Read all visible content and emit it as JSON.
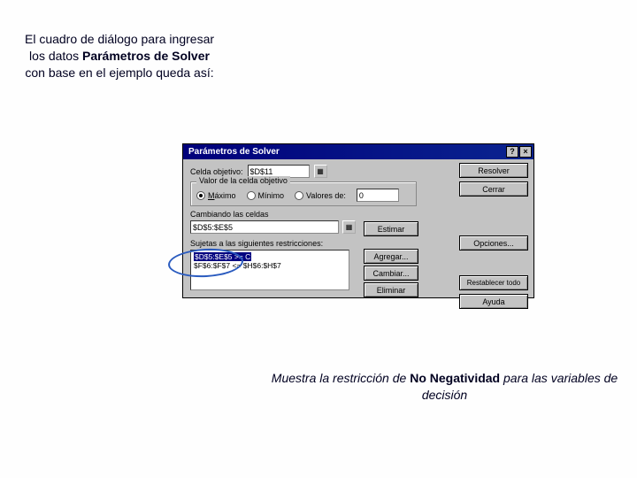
{
  "captionTop": {
    "line1": "El cuadro de diálogo para ingresar los datos ",
    "bold": "Parámetros de Solver",
    "line2": " con base en el ejemplo queda así:"
  },
  "captionBottom": {
    "pre": "Muestra la restricción de ",
    "bold": "No Negatividad",
    "post": " para las variables de decisión"
  },
  "dialog": {
    "title": "Parámetros de Solver",
    "helpGlyph": "?",
    "closeGlyph": "×",
    "labels": {
      "celdaObjetivo": "Celda objetivo:",
      "valorCelda": "Valor de la celda objetivo",
      "maximo": "Máximo",
      "minimo": "Mínimo",
      "valoresDe": "Valores de:",
      "cambiando": "Cambiando las celdas",
      "sujetas": "Sujetas a las siguientes restricciones:"
    },
    "inputs": {
      "objetivo": "$D$11",
      "valoresDe": "0",
      "cambiando": "$D$5:$E$5",
      "valoresPh": ""
    },
    "constraints": [
      "$D$5:$E$5 >= C",
      "$F$6:$F$7 <= $H$6:$H$7"
    ],
    "buttons": {
      "resolver": "Resolver",
      "cerrar": "Cerrar",
      "opciones": "Opciones...",
      "restablecer": "Restablecer todo",
      "ayuda": "Ayuda",
      "estimar": "Estimar",
      "agregar": "Agregar...",
      "cambiar": "Cambiar...",
      "eliminar": "Eliminar"
    },
    "rangeIcon": "▦"
  }
}
